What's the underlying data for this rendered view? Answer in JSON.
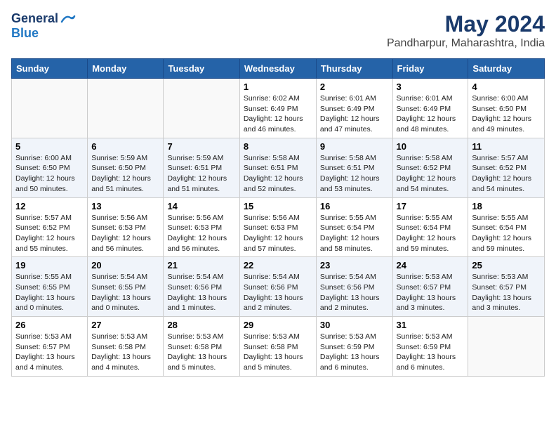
{
  "header": {
    "logo_general": "General",
    "logo_blue": "Blue",
    "title": "May 2024",
    "subtitle": "Pandharpur, Maharashtra, India"
  },
  "weekdays": [
    "Sunday",
    "Monday",
    "Tuesday",
    "Wednesday",
    "Thursday",
    "Friday",
    "Saturday"
  ],
  "weeks": [
    [
      {
        "day": "",
        "info": ""
      },
      {
        "day": "",
        "info": ""
      },
      {
        "day": "",
        "info": ""
      },
      {
        "day": "1",
        "info": "Sunrise: 6:02 AM\nSunset: 6:49 PM\nDaylight: 12 hours and 46 minutes."
      },
      {
        "day": "2",
        "info": "Sunrise: 6:01 AM\nSunset: 6:49 PM\nDaylight: 12 hours and 47 minutes."
      },
      {
        "day": "3",
        "info": "Sunrise: 6:01 AM\nSunset: 6:49 PM\nDaylight: 12 hours and 48 minutes."
      },
      {
        "day": "4",
        "info": "Sunrise: 6:00 AM\nSunset: 6:50 PM\nDaylight: 12 hours and 49 minutes."
      }
    ],
    [
      {
        "day": "5",
        "info": "Sunrise: 6:00 AM\nSunset: 6:50 PM\nDaylight: 12 hours and 50 minutes."
      },
      {
        "day": "6",
        "info": "Sunrise: 5:59 AM\nSunset: 6:50 PM\nDaylight: 12 hours and 51 minutes."
      },
      {
        "day": "7",
        "info": "Sunrise: 5:59 AM\nSunset: 6:51 PM\nDaylight: 12 hours and 51 minutes."
      },
      {
        "day": "8",
        "info": "Sunrise: 5:58 AM\nSunset: 6:51 PM\nDaylight: 12 hours and 52 minutes."
      },
      {
        "day": "9",
        "info": "Sunrise: 5:58 AM\nSunset: 6:51 PM\nDaylight: 12 hours and 53 minutes."
      },
      {
        "day": "10",
        "info": "Sunrise: 5:58 AM\nSunset: 6:52 PM\nDaylight: 12 hours and 54 minutes."
      },
      {
        "day": "11",
        "info": "Sunrise: 5:57 AM\nSunset: 6:52 PM\nDaylight: 12 hours and 54 minutes."
      }
    ],
    [
      {
        "day": "12",
        "info": "Sunrise: 5:57 AM\nSunset: 6:52 PM\nDaylight: 12 hours and 55 minutes."
      },
      {
        "day": "13",
        "info": "Sunrise: 5:56 AM\nSunset: 6:53 PM\nDaylight: 12 hours and 56 minutes."
      },
      {
        "day": "14",
        "info": "Sunrise: 5:56 AM\nSunset: 6:53 PM\nDaylight: 12 hours and 56 minutes."
      },
      {
        "day": "15",
        "info": "Sunrise: 5:56 AM\nSunset: 6:53 PM\nDaylight: 12 hours and 57 minutes."
      },
      {
        "day": "16",
        "info": "Sunrise: 5:55 AM\nSunset: 6:54 PM\nDaylight: 12 hours and 58 minutes."
      },
      {
        "day": "17",
        "info": "Sunrise: 5:55 AM\nSunset: 6:54 PM\nDaylight: 12 hours and 59 minutes."
      },
      {
        "day": "18",
        "info": "Sunrise: 5:55 AM\nSunset: 6:54 PM\nDaylight: 12 hours and 59 minutes."
      }
    ],
    [
      {
        "day": "19",
        "info": "Sunrise: 5:55 AM\nSunset: 6:55 PM\nDaylight: 13 hours and 0 minutes."
      },
      {
        "day": "20",
        "info": "Sunrise: 5:54 AM\nSunset: 6:55 PM\nDaylight: 13 hours and 0 minutes."
      },
      {
        "day": "21",
        "info": "Sunrise: 5:54 AM\nSunset: 6:56 PM\nDaylight: 13 hours and 1 minutes."
      },
      {
        "day": "22",
        "info": "Sunrise: 5:54 AM\nSunset: 6:56 PM\nDaylight: 13 hours and 2 minutes."
      },
      {
        "day": "23",
        "info": "Sunrise: 5:54 AM\nSunset: 6:56 PM\nDaylight: 13 hours and 2 minutes."
      },
      {
        "day": "24",
        "info": "Sunrise: 5:53 AM\nSunset: 6:57 PM\nDaylight: 13 hours and 3 minutes."
      },
      {
        "day": "25",
        "info": "Sunrise: 5:53 AM\nSunset: 6:57 PM\nDaylight: 13 hours and 3 minutes."
      }
    ],
    [
      {
        "day": "26",
        "info": "Sunrise: 5:53 AM\nSunset: 6:57 PM\nDaylight: 13 hours and 4 minutes."
      },
      {
        "day": "27",
        "info": "Sunrise: 5:53 AM\nSunset: 6:58 PM\nDaylight: 13 hours and 4 minutes."
      },
      {
        "day": "28",
        "info": "Sunrise: 5:53 AM\nSunset: 6:58 PM\nDaylight: 13 hours and 5 minutes."
      },
      {
        "day": "29",
        "info": "Sunrise: 5:53 AM\nSunset: 6:58 PM\nDaylight: 13 hours and 5 minutes."
      },
      {
        "day": "30",
        "info": "Sunrise: 5:53 AM\nSunset: 6:59 PM\nDaylight: 13 hours and 6 minutes."
      },
      {
        "day": "31",
        "info": "Sunrise: 5:53 AM\nSunset: 6:59 PM\nDaylight: 13 hours and 6 minutes."
      },
      {
        "day": "",
        "info": ""
      }
    ]
  ]
}
